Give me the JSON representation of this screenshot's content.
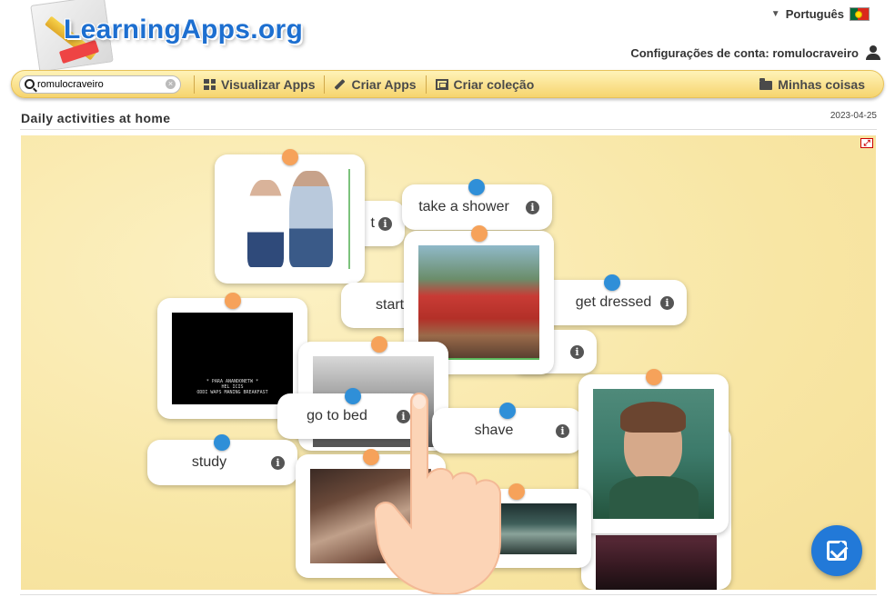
{
  "logo": {
    "text": "LearningApps.org"
  },
  "language": {
    "label": "Português"
  },
  "account": {
    "label": "Configurações de conta: romulocraveiro"
  },
  "search": {
    "value": "romulocraveiro"
  },
  "nav": {
    "view_apps": "Visualizar Apps",
    "create_apps": "Criar Apps",
    "create_collection": "Criar coleção",
    "my_stuff": "Minhas coisas"
  },
  "app": {
    "title": "Daily activities at home",
    "date": "2023-04-25"
  },
  "cards": {
    "take_a_shower": "take a shower",
    "start": "start",
    "get_dressed": "get dressed",
    "go_to_bed": "go to bed",
    "shave": "shave",
    "study": "study",
    "partial_t": "t"
  },
  "video_caption": "* PARA ANANDONETW *\nHEL ICIS\nODDI WAPS MANING BREAKFAST",
  "colors": {
    "accent": "#2279d8",
    "pin_orange": "#f6a25a",
    "pin_blue": "#2f8fd8",
    "nav_bg": "#f6d46e"
  },
  "icons": [
    "search-icon",
    "clear-icon",
    "grid-icon",
    "pencil-icon",
    "collection-icon",
    "folder-icon",
    "user-icon",
    "info-icon",
    "fullscreen-icon",
    "check-icon",
    "flag-icon"
  ]
}
